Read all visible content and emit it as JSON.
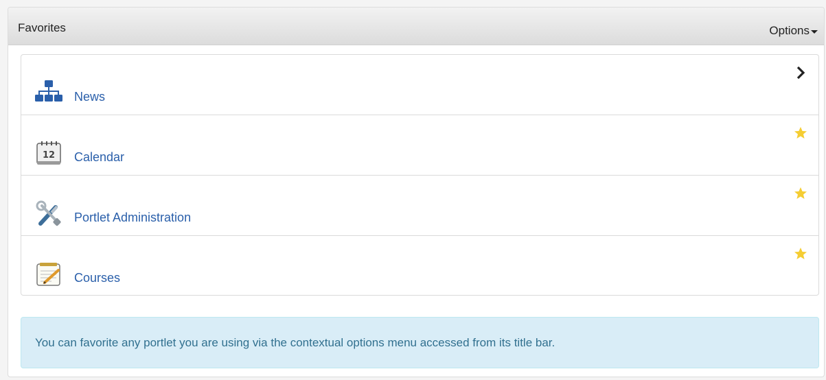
{
  "portlet": {
    "title": "Favorites",
    "options_label": "Options"
  },
  "favorites": [
    {
      "label": "News",
      "icon": "sitemap-icon",
      "action": "chevron-right-icon"
    },
    {
      "label": "Calendar",
      "icon": "calendar-icon",
      "action": "star-icon"
    },
    {
      "label": "Portlet Administration",
      "icon": "tools-icon",
      "action": "star-icon"
    },
    {
      "label": "Courses",
      "icon": "notepad-icon",
      "action": "star-icon"
    }
  ],
  "info": {
    "message": "You can favorite any portlet you are using via the contextual options menu accessed from its title bar."
  },
  "colors": {
    "link": "#2a5faa",
    "star": "#f5cd33",
    "info_bg": "#d9edf7",
    "info_text": "#31708f"
  }
}
